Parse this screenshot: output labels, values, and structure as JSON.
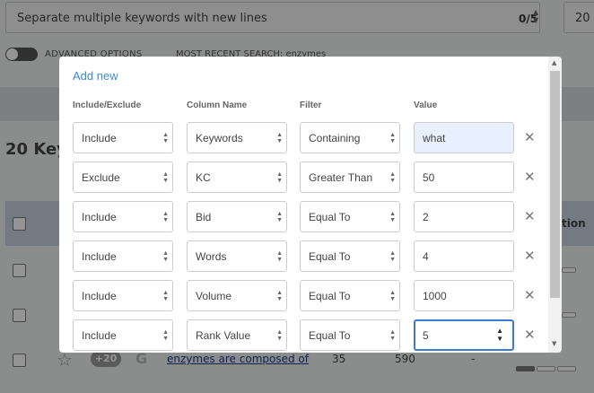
{
  "search": {
    "placeholder": "Separate multiple keywords with new lines",
    "count": "0/5",
    "results_value": "20"
  },
  "options": {
    "advanced_label": "ADVANCED OPTIONS",
    "recent_label": "MOST RECENT SEARCH: enzymes"
  },
  "results": {
    "heading": "20 Key",
    "action_col": "tion",
    "row": {
      "badge": "+20",
      "engine_icon": "G",
      "keyword": "enzymes are composed of",
      "kc": "35",
      "volume": "590",
      "dash": "-"
    }
  },
  "modal": {
    "add_new": "Add new",
    "headers": {
      "include": "Include/Exclude",
      "column": "Column Name",
      "filter": "Filter",
      "value": "Value"
    },
    "filters": [
      {
        "mode": "Include",
        "column": "Keywords",
        "filter": "Containing",
        "value": "what"
      },
      {
        "mode": "Exclude",
        "column": "KC",
        "filter": "Greater Than",
        "value": "50"
      },
      {
        "mode": "Include",
        "column": "Bid",
        "filter": "Equal To",
        "value": "2"
      },
      {
        "mode": "Include",
        "column": "Words",
        "filter": "Equal To",
        "value": "4"
      },
      {
        "mode": "Include",
        "column": "Volume",
        "filter": "Equal To",
        "value": "1000"
      },
      {
        "mode": "Include",
        "column": "Rank Value",
        "filter": "Equal To",
        "value": "5"
      }
    ],
    "remove_glyph": "✕"
  },
  "colors": {
    "accent": "#3a8ad6",
    "overlay": "rgba(0,0,0,0.42)",
    "value_highlight": "#e8f0fd",
    "table_header": "#c6d3e0"
  }
}
